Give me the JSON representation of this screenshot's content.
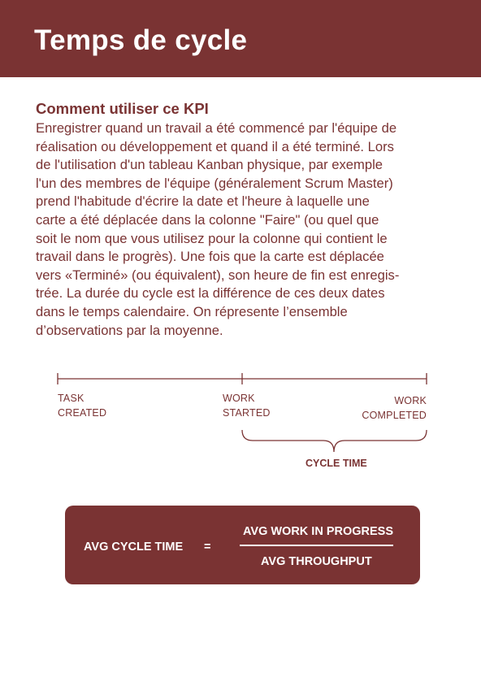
{
  "header": {
    "title": "Temps de cycle"
  },
  "section": {
    "heading": "Comment utiliser ce KPI",
    "lines": [
      "Enregistrer quand un travail a été commencé par l'équipe de",
      "réalisation ou développement et quand il a été terminé. Lors",
      "de l'utilisation d'un tableau Kanban physique, par exemple",
      "l'un des membres de l'équipe (généralement Scrum Master)",
      "prend l'habitude d'écrire la date et l'heure à laquelle une",
      "carte a été déplacée dans la colonne \"Faire\" (ou quel que",
      "soit le nom que vous utilisez pour la colonne qui contient le",
      "travail dans le progrès). Une fois que la carte est déplacée",
      "vers «Terminé» (ou équivalent), son heure de fin est enregis-",
      "trée. La durée du cycle est la différence de ces deux dates",
      "dans le temps calendaire. On répresente l’ensemble",
      "d’observations par la moyenne."
    ]
  },
  "timeline": {
    "task_created": [
      "TASK",
      "CREATED"
    ],
    "work_started": [
      "WORK",
      "STARTED"
    ],
    "work_completed": [
      "WORK",
      "COMPLETED"
    ],
    "cycle_time": "CYCLE TIME"
  },
  "formula": {
    "left": "AVG CYCLE TIME",
    "equals": "=",
    "numerator": "AVG WORK IN PROGRESS",
    "denominator": "AVG THROUGHPUT"
  },
  "colors": {
    "brand": "#7a3333",
    "background": "#ffffff"
  }
}
